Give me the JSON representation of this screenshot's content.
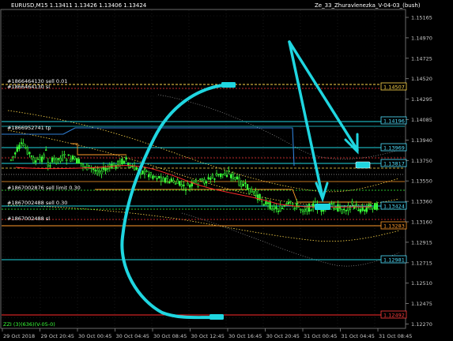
{
  "window": {
    "symbol_title": "EURUSD,M15  1.13411  1.13426  1.13406  1.13424",
    "indicator_title": "Ze_33_Zhuravlenezka_V-04-03_(bush)",
    "footer_text": "ZZI (3)(636)(V-05-0)"
  },
  "price_axis": {
    "labels": [
      "1.15165",
      "1.14970",
      "1.14725",
      "1.14520",
      "1.14295",
      "1.14085",
      "1.13940",
      "1.13750",
      "1.13550",
      "1.13360",
      "1.13160",
      "1.12915",
      "1.12715",
      "1.12510",
      "1.12475",
      "1.12270"
    ]
  },
  "time_axis": {
    "labels": [
      "29 Oct 2018",
      "29 Oct 20:45",
      "30 Oct 00:45",
      "30 Oct 04:45",
      "30 Oct 08:45",
      "30 Oct 12:45",
      "30 Oct 16:45",
      "30 Oct 20:45",
      "31 Oct 00:45",
      "31 Oct 04:45",
      "31 Oct 08:45"
    ]
  },
  "level_tags": [
    {
      "text": "1.14507",
      "color": "#ffd84a"
    },
    {
      "text": "1.14196",
      "color": "#4fe0ff"
    },
    {
      "text": "1.13969",
      "color": "#4fe0ff"
    },
    {
      "text": "1.13817",
      "color": "#4fe0ff"
    },
    {
      "text": "1.13424",
      "color": "#4fe0ff"
    },
    {
      "text": "1.13283",
      "color": "#ff9a2a"
    },
    {
      "text": "1.12981",
      "color": "#4fe0ff"
    },
    {
      "text": "1.12492",
      "color": "#ff3b3b"
    }
  ],
  "order_labels": [
    {
      "text": "#1866464130 sell 0.01",
      "color": "#ffffff"
    },
    {
      "text": "#1866464130 sl",
      "color": "#ffffff"
    },
    {
      "text": "#1866952741 tp",
      "color": "#ffffff"
    },
    {
      "text": "#1867002876 sell limit 0.30",
      "color": "#ffffff"
    },
    {
      "text": "#1867002488 sell 0.30",
      "color": "#ffffff"
    },
    {
      "text": "#1867002488 sl",
      "color": "#ffffff"
    }
  ],
  "colors": {
    "background": "#000000",
    "grid": "#2c2c2c",
    "cyan": "#1fd6e0",
    "candles": "#39ff39",
    "orange": "#ff9a2a",
    "red": "#ff2a2a",
    "yellow": "#ffd84a",
    "blue": "#2f7fd6"
  }
}
